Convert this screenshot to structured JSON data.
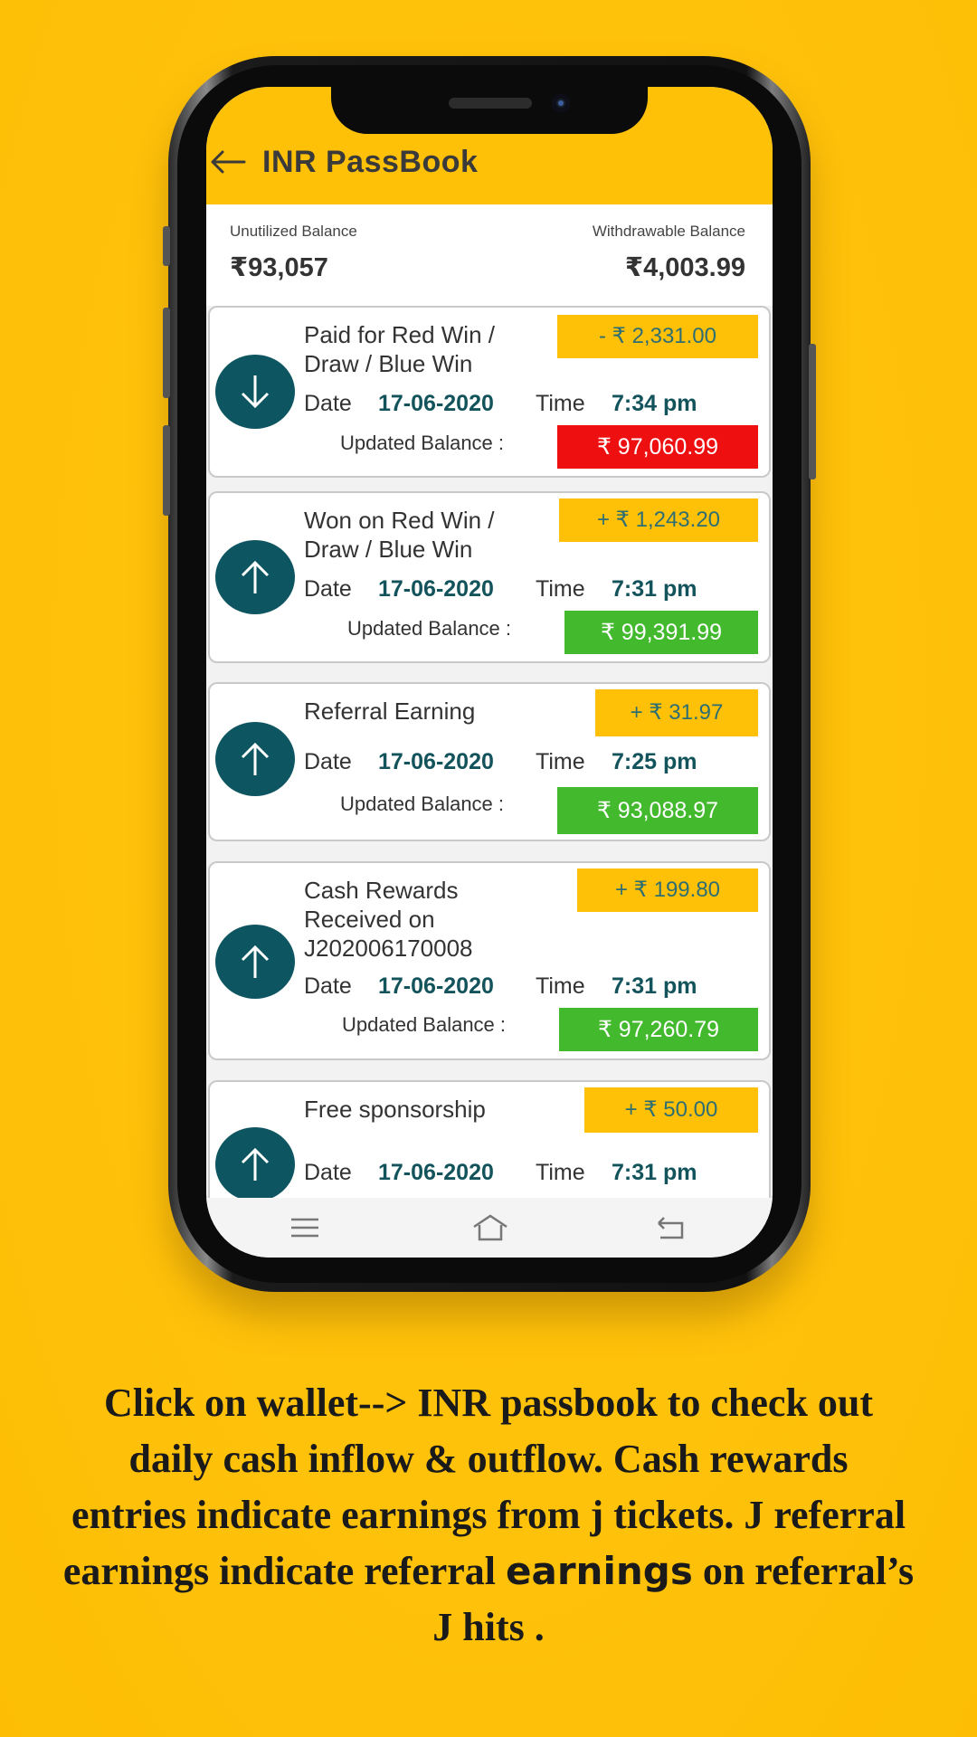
{
  "app": {
    "title": "INR PassBook",
    "accent_color": "#FFC107"
  },
  "balances": {
    "unutilized_label": "Unutilized Balance",
    "unutilized_value": "₹93,057",
    "withdrawable_label": "Withdrawable Balance",
    "withdrawable_value": "₹4,003.99"
  },
  "transactions": [
    {
      "direction": "down",
      "description_lines": [
        "Paid for Red Win /",
        "Draw / Blue Win"
      ],
      "amount": "-  ₹ 2,331.00",
      "date_label": "Date",
      "date": "17-06-2020",
      "time_label": "Time",
      "time": "7:34 pm",
      "updated_label": "Updated Balance :",
      "updated_balance": "₹ 97,060.99",
      "balance_color": "#EE1010"
    },
    {
      "direction": "up",
      "description_lines": [
        "Won on Red Win /",
        "Draw / Blue Win"
      ],
      "amount": "+ ₹ 1,243.20",
      "date_label": "Date",
      "date": "17-06-2020",
      "time_label": "Time",
      "time": "7:31 pm",
      "updated_label": "Updated Balance :",
      "updated_balance": "₹ 99,391.99",
      "balance_color": "#43B92E"
    },
    {
      "direction": "up",
      "description_lines": [
        "Referral Earning"
      ],
      "amount": "+ ₹ 31.97",
      "date_label": "Date",
      "date": "17-06-2020",
      "time_label": "Time",
      "time": "7:25 pm",
      "updated_label": "Updated Balance :",
      "updated_balance": "₹ 93,088.97",
      "balance_color": "#43B92E"
    },
    {
      "direction": "up",
      "description_lines": [
        "Cash Rewards",
        "Received on",
        "J202006170008"
      ],
      "amount": "+ ₹ 199.80",
      "date_label": "Date",
      "date": "17-06-2020",
      "time_label": "Time",
      "time": "7:31 pm",
      "updated_label": "Updated Balance :",
      "updated_balance": "₹ 97,260.79",
      "balance_color": "#43B92E"
    },
    {
      "direction": "up",
      "description_lines": [
        "Free sponsorship"
      ],
      "amount": "+ ₹ 50.00",
      "date_label": "Date",
      "date": "17-06-2020",
      "time_label": "Time",
      "time": "7:31 pm",
      "updated_label": "",
      "updated_balance": "",
      "balance_color": "#43B92E"
    }
  ],
  "navbar": {
    "icons": [
      "menu-icon",
      "home-icon",
      "back-nav-icon"
    ]
  },
  "caption": {
    "line1": "Click on wallet--> INR passbook to check out",
    "line2": "daily cash inflow & outflow. Cash rewards",
    "line3": "entries indicate earnings from j tickets. J referral",
    "line4_a": "earnings indicate referral ",
    "line4_b": "earnings",
    "line4_c": " on referral’s",
    "line5": "J hits ."
  }
}
